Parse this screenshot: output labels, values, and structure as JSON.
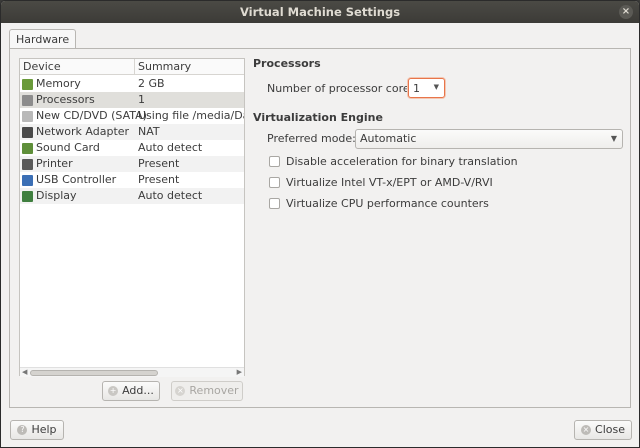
{
  "window": {
    "title": "Virtual Machine Settings",
    "close_glyph": "×"
  },
  "tabs": [
    {
      "label": "Hardware"
    }
  ],
  "device_list": {
    "col_device": "Device",
    "col_summary": "Summary",
    "rows": [
      {
        "device": "Memory",
        "summary": "2 GB",
        "icon": "memory-icon",
        "color": "#6a9a3a"
      },
      {
        "device": "Processors",
        "summary": "1",
        "icon": "processor-icon",
        "color": "#8c8c8c",
        "selected": true
      },
      {
        "device": "New CD/DVD (SATA)",
        "summary": "Using file /media/Dade",
        "icon": "cd-dvd-icon",
        "color": "#b9b9b9"
      },
      {
        "device": "Network Adapter",
        "summary": "NAT",
        "icon": "network-adapter-icon",
        "color": "#4a4a4a"
      },
      {
        "device": "Sound Card",
        "summary": "Auto detect",
        "icon": "sound-card-icon",
        "color": "#5f8f3a"
      },
      {
        "device": "Printer",
        "summary": "Present",
        "icon": "printer-icon",
        "color": "#5a5a5a"
      },
      {
        "device": "USB Controller",
        "summary": "Present",
        "icon": "usb-icon",
        "color": "#3b6fb5"
      },
      {
        "device": "Display",
        "summary": "Auto detect",
        "icon": "display-icon",
        "color": "#3f7f3f"
      }
    ]
  },
  "buttons": {
    "add": "Add...",
    "remove": "Remover",
    "help": "Help",
    "close": "Close"
  },
  "processors": {
    "title": "Processors",
    "cores_label": "Number of processor cores:",
    "cores_value": "1"
  },
  "virtualization": {
    "title": "Virtualization Engine",
    "mode_label": "Preferred mode:",
    "mode_value": "Automatic",
    "options": [
      {
        "label": "Disable acceleration for binary translation",
        "checked": false
      },
      {
        "label": "Virtualize Intel VT-x/EPT or AMD-V/RVI",
        "checked": false
      },
      {
        "label": "Virtualize CPU performance counters",
        "checked": false
      }
    ]
  }
}
